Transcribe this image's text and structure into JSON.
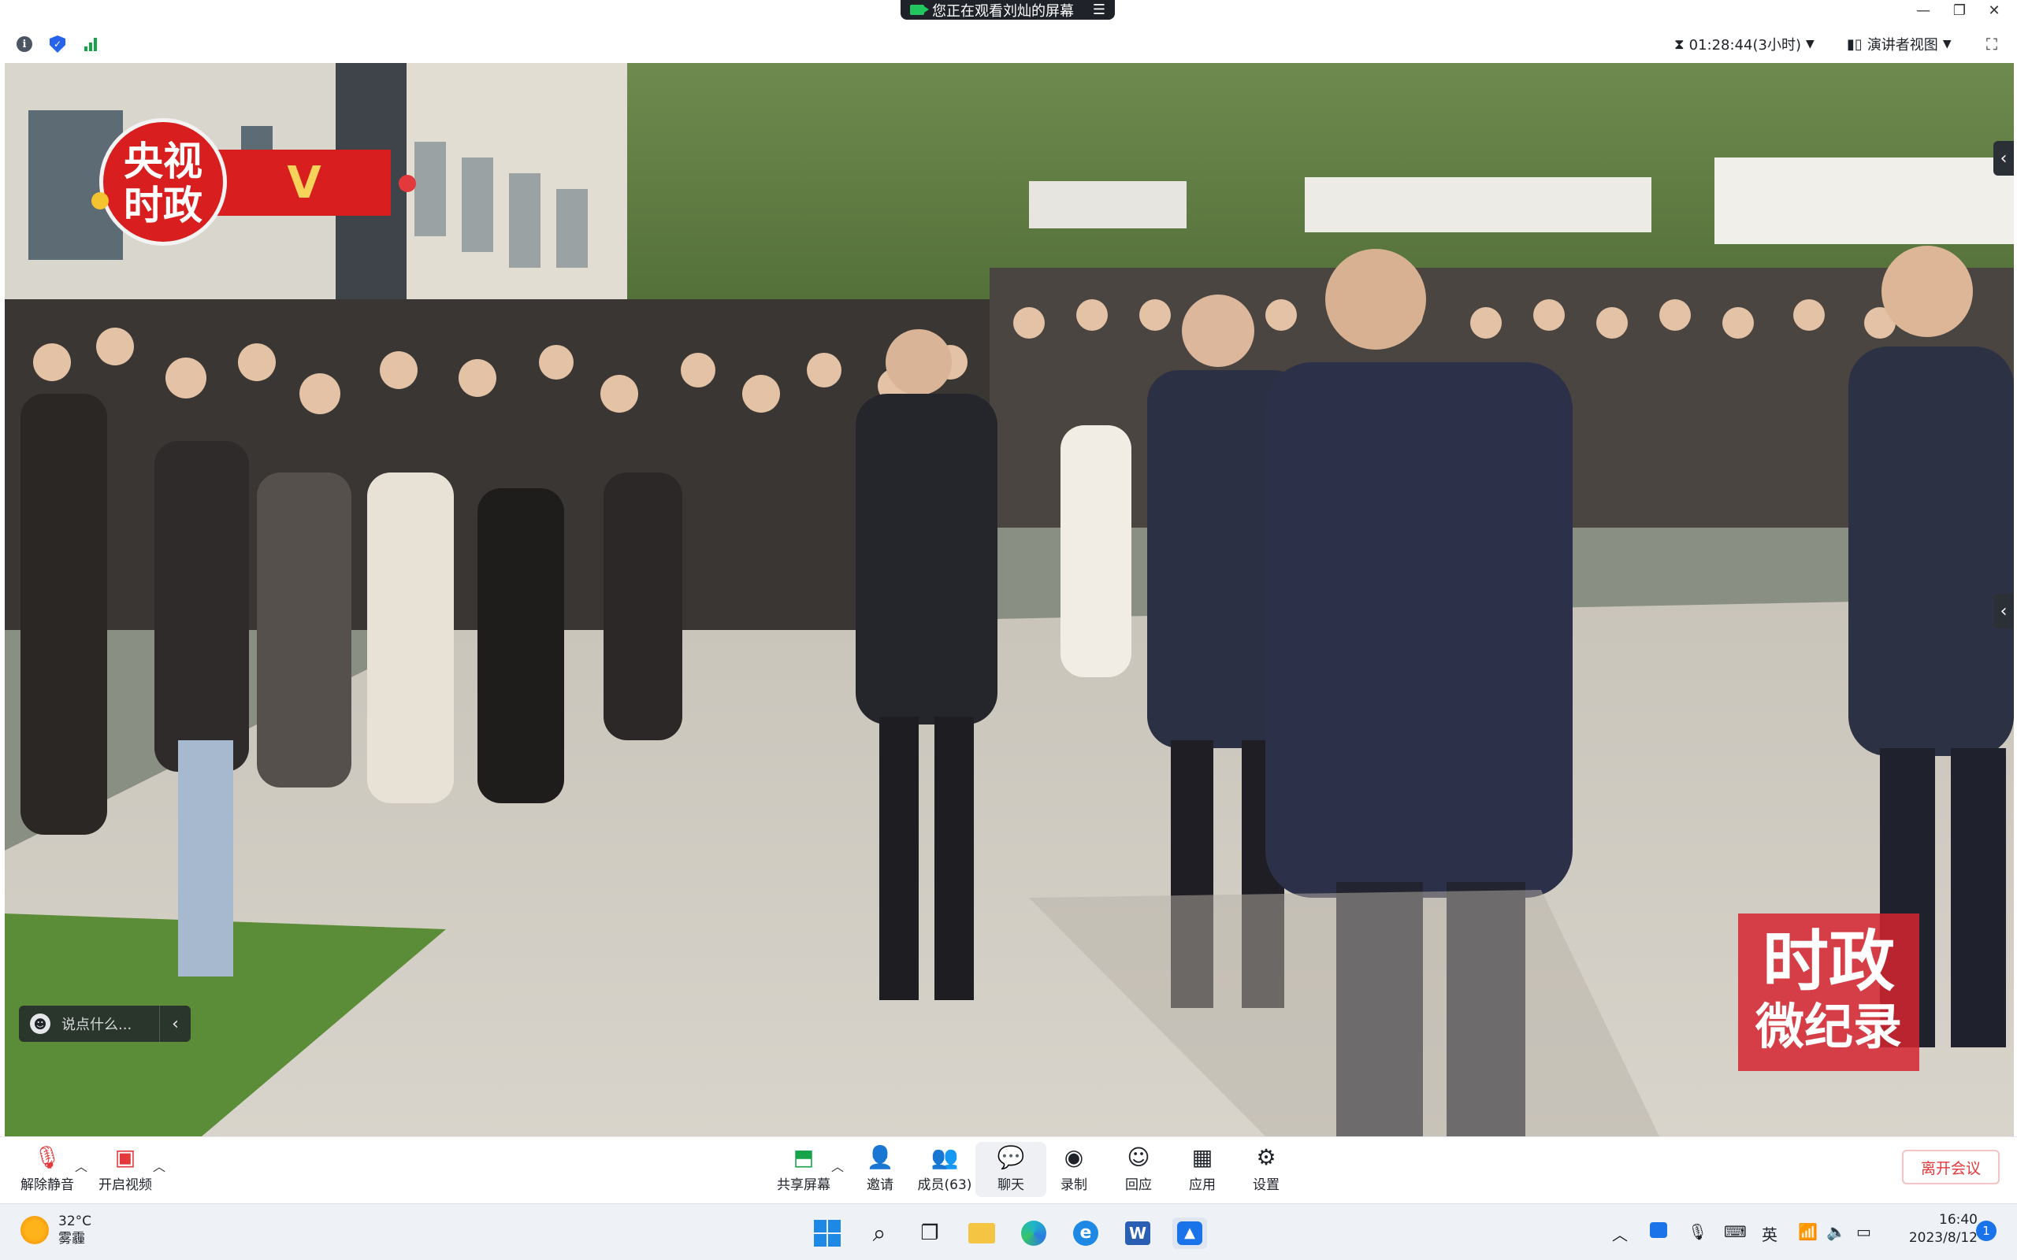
{
  "window": {
    "share_banner": "您正在观看刘灿的屏幕",
    "controls": [
      "—",
      "❐",
      "✕"
    ]
  },
  "infobar": {
    "elapsed": "01:28:44(3小时)",
    "view_mode": "演讲者视图"
  },
  "video": {
    "cctv_logo_line1": "央视",
    "cctv_logo_line2": "时政",
    "cctv_logo_mark": "V",
    "series_line1": "时政",
    "series_line2": "微纪录"
  },
  "chat_input": {
    "placeholder": "说点什么..."
  },
  "toolbar": {
    "unmute": "解除静音",
    "start_video": "开启视频",
    "share_screen": "共享屏幕",
    "invite": "邀请",
    "members": "成员(63)",
    "chat": "聊天",
    "record": "录制",
    "reactions": "回应",
    "apps": "应用",
    "settings": "设置",
    "leave": "离开会议"
  },
  "taskbar": {
    "temperature": "32°C",
    "weather": "雾霾",
    "ime": "英",
    "time": "16:40",
    "date": "2023/8/12",
    "notifications": "1"
  },
  "colors": {
    "accent_red": "#e4393c",
    "cctv_red": "#d81e1e",
    "signal_green": "#16a34a",
    "shield_blue": "#2563eb"
  }
}
